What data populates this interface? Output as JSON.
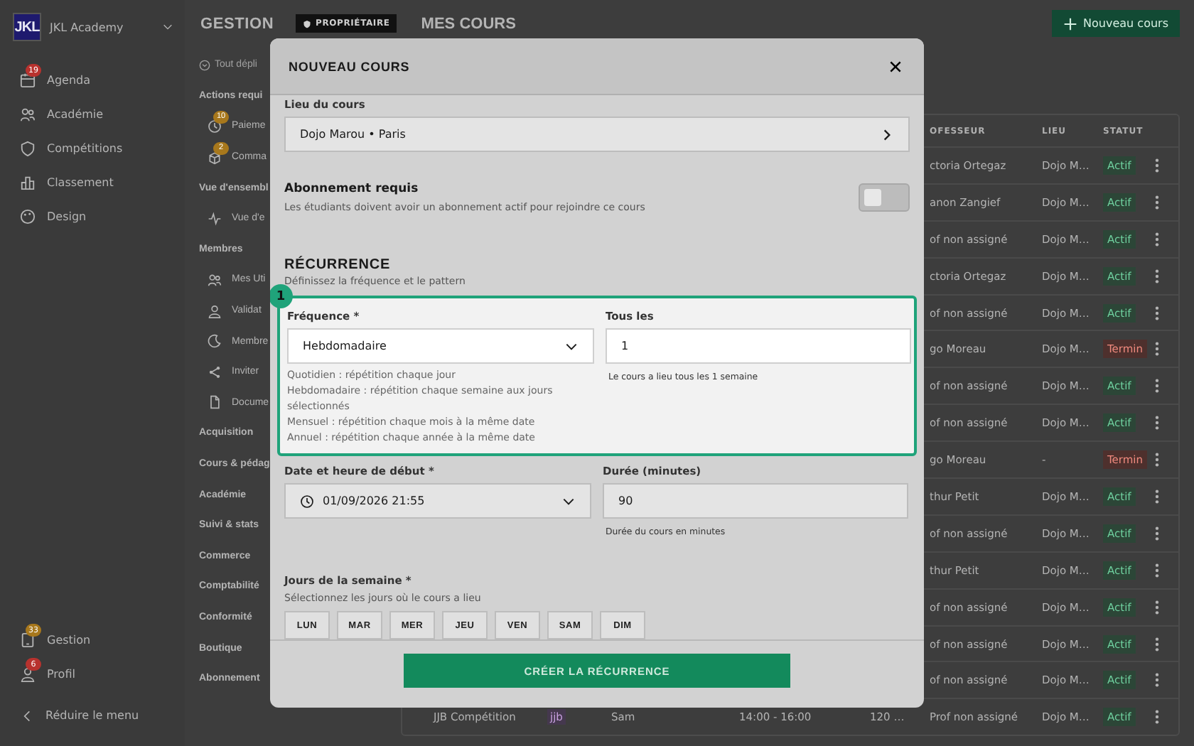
{
  "sidebar": {
    "logo": "JKL",
    "academy": "JKL Academy",
    "nav": [
      {
        "label": "Agenda",
        "badge": {
          "text": "19",
          "color": "#b8322e"
        }
      },
      {
        "label": "Académie"
      },
      {
        "label": "Compétitions"
      },
      {
        "label": "Classement"
      },
      {
        "label": "Design"
      }
    ],
    "bottom": [
      {
        "label": "Gestion",
        "badge": {
          "text": "33",
          "color": "#a8781c"
        }
      },
      {
        "label": "Profil",
        "badge": {
          "text": "6",
          "color": "#b8322e"
        }
      }
    ],
    "collapse": "Réduire le menu"
  },
  "header": {
    "section": "GESTION",
    "role": "PROPRIÉTAIRE",
    "page": "MES COURS",
    "new_button": "Nouveau cours"
  },
  "gestion": [
    {
      "kind": "expand",
      "label": "Tout dépli"
    },
    {
      "kind": "section",
      "label": "Actions requi"
    },
    {
      "kind": "item",
      "label": "Paieme",
      "badge": {
        "text": "10",
        "color": "#a8781c"
      }
    },
    {
      "kind": "item",
      "label": "Comma",
      "badge": {
        "text": "2",
        "color": "#a8781c"
      }
    },
    {
      "kind": "section",
      "label": "Vue d'ensembl"
    },
    {
      "kind": "item",
      "label": "Vue d'e"
    },
    {
      "kind": "section",
      "label": "Membres"
    },
    {
      "kind": "item",
      "label": "Mes Uti"
    },
    {
      "kind": "item",
      "label": "Validat"
    },
    {
      "kind": "item",
      "label": "Membre"
    },
    {
      "kind": "item",
      "label": "Inviter"
    },
    {
      "kind": "item",
      "label": "Docume"
    },
    {
      "kind": "section",
      "label": "Acquisition"
    },
    {
      "kind": "section",
      "label": "Cours & pédag"
    },
    {
      "kind": "section",
      "label": "Académie"
    },
    {
      "kind": "section",
      "label": "Suivi & stats"
    },
    {
      "kind": "section",
      "label": "Commerce"
    },
    {
      "kind": "section",
      "label": "Comptabilité"
    },
    {
      "kind": "section",
      "label": "Conformité"
    },
    {
      "kind": "section",
      "label": "Boutique"
    },
    {
      "kind": "section",
      "label": "Abonnement"
    }
  ],
  "table": {
    "columns": [
      "OFESSEUR",
      "LIEU",
      "STATUT"
    ],
    "rows": [
      {
        "professeur": "ctoria Ortegaz",
        "lieu": "Dojo M…",
        "statut": {
          "text": "Actif",
          "kind": "active"
        }
      },
      {
        "professeur": "anon Zangief",
        "lieu": "Dojo M…",
        "statut": {
          "text": "Actif",
          "kind": "active"
        }
      },
      {
        "professeur": "of non assigné",
        "lieu": "Dojo M…",
        "statut": {
          "text": "Actif",
          "kind": "active"
        }
      },
      {
        "professeur": "ctoria Ortegaz",
        "lieu": "Dojo M…",
        "statut": {
          "text": "Actif",
          "kind": "active"
        }
      },
      {
        "professeur": "of non assigné",
        "lieu": "Dojo M…",
        "statut": {
          "text": "Actif",
          "kind": "active"
        }
      },
      {
        "professeur": "go Moreau",
        "lieu": "Dojo M…",
        "statut": {
          "text": "Termin",
          "kind": "ended"
        }
      },
      {
        "professeur": "of non assigné",
        "lieu": "Dojo M…",
        "statut": {
          "text": "Actif",
          "kind": "active"
        }
      },
      {
        "professeur": "of non assigné",
        "lieu": "Dojo M…",
        "statut": {
          "text": "Actif",
          "kind": "active"
        }
      },
      {
        "professeur": "go Moreau",
        "lieu": "-",
        "statut": {
          "text": "Termin",
          "kind": "ended"
        }
      },
      {
        "professeur": "thur Petit",
        "lieu": "Dojo M…",
        "statut": {
          "text": "Actif",
          "kind": "active"
        }
      },
      {
        "professeur": "of non assigné",
        "lieu": "Dojo M…",
        "statut": {
          "text": "Actif",
          "kind": "active"
        }
      },
      {
        "professeur": "thur Petit",
        "lieu": "Dojo M…",
        "statut": {
          "text": "Actif",
          "kind": "active"
        }
      },
      {
        "professeur": "of non assigné",
        "lieu": "Dojo M…",
        "statut": {
          "text": "Actif",
          "kind": "active"
        }
      },
      {
        "professeur": "of non assigné",
        "lieu": "Dojo M…",
        "statut": {
          "text": "Actif",
          "kind": "active"
        }
      },
      {
        "professeur": "of non assigné",
        "lieu": "Dojo M…",
        "statut": {
          "text": "Actif",
          "kind": "active"
        }
      },
      {
        "nom": "JJB Compétition",
        "discipline": "jjb",
        "jour": "Sam",
        "horaire": "14:00 - 16:00",
        "duree": "120 …",
        "professeur": "Prof non assigné",
        "lieu": "Dojo M…",
        "statut": {
          "text": "Actif",
          "kind": "active"
        }
      }
    ]
  },
  "modal": {
    "title": "NOUVEAU COURS",
    "location": {
      "label": "Lieu du cours",
      "value": "Dojo Marou • Paris"
    },
    "subscription": {
      "title": "Abonnement requis",
      "description": "Les étudiants doivent avoir un abonnement actif pour rejoindre ce cours",
      "on": false
    },
    "recurrence": {
      "title": "RÉCURRENCE",
      "subtitle": "Définissez la fréquence et le pattern",
      "callout": "1",
      "frequency": {
        "label": "Fréquence *",
        "value": "Hebdomadaire",
        "help": [
          "Quotidien : répétition chaque jour",
          "Hebdomadaire : répétition chaque semaine aux jours sélectionnés",
          "Mensuel : répétition chaque mois à la même date",
          "Annuel : répétition chaque année à la même date"
        ]
      },
      "interval": {
        "label": "Tous les",
        "value": "1",
        "help": "Le cours a lieu tous les 1 semaine"
      }
    },
    "start": {
      "label": "Date et heure de début *",
      "value": "01/09/2026 21:55"
    },
    "duration": {
      "label": "Durée (minutes)",
      "value": "90",
      "help": "Durée du cours en minutes"
    },
    "days": {
      "label": "Jours de la semaine *",
      "hint": "Sélectionnez les jours où le cours a lieu",
      "items": [
        {
          "label": "LUN",
          "selected": false
        },
        {
          "label": "MAR",
          "selected": false
        },
        {
          "label": "MER",
          "selected": false
        },
        {
          "label": "JEU",
          "selected": false
        },
        {
          "label": "VEN",
          "selected": false
        },
        {
          "label": "SAM",
          "selected": false
        },
        {
          "label": "DIM",
          "selected": false
        }
      ]
    },
    "submit": "CRÉER LA RÉCURRENCE"
  }
}
